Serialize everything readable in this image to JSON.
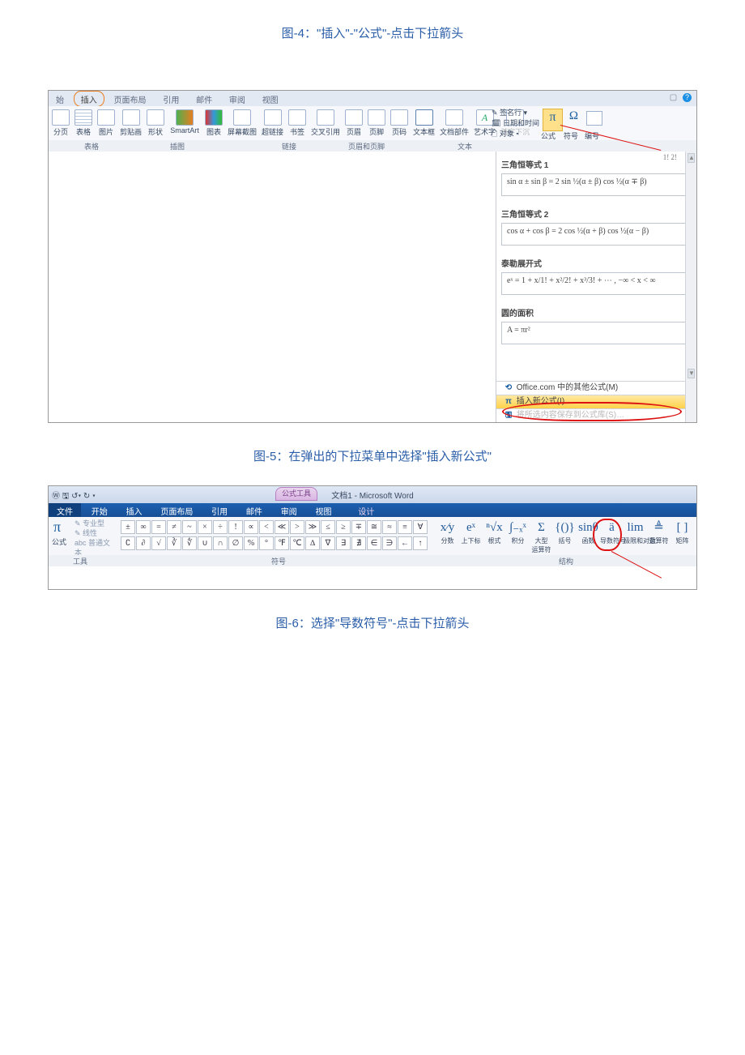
{
  "captions": {
    "c4": "图-4：\"插入\"-\"公式\"-点击下拉箭头",
    "c5": "图-5：在弹出的下拉菜单中选择\"插入新公式\"",
    "c6": "图-6：选择\"导数符号\"-点击下拉箭头"
  },
  "shot1": {
    "tabs": {
      "t0": "始",
      "t1": "插入",
      "t2": "页面布局",
      "t3": "引用",
      "t4": "邮件",
      "t5": "审阅",
      "t6": "视图"
    },
    "help_icon": "?",
    "ribbon_items": {
      "i0": "分页",
      "i1": "表格",
      "i2": "图片",
      "i3": "剪贴画",
      "i4": "形状",
      "i5": "SmartArt",
      "i6": "图表",
      "i7": "屏幕截图",
      "i8": "超链接",
      "i9": "书签",
      "i10": "交叉引用",
      "i11": "页眉",
      "i12": "页脚",
      "i13": "页码",
      "i14": "文本框",
      "i15": "文档部件",
      "i16": "艺术字",
      "i17": "首字下沉",
      "i18": "签名行 ▾",
      "i19": "日期和时间",
      "i20": "对象 ▾",
      "i21": "公式",
      "i22": "符号",
      "i23": "编号"
    },
    "ribbon_groups": {
      "g1": "表格",
      "g2": "插图",
      "g3": "链接",
      "g4": "页眉和页脚",
      "g5": "文本"
    },
    "pi": "π",
    "omega": "Ω",
    "frac_hint": "1!    2!",
    "panel": {
      "h1": "三角恒等式 1",
      "e1": "sin α ± sin β = 2 sin ½(α ± β) cos ½(α ∓ β)",
      "h2": "三角恒等式 2",
      "e2": "cos α + cos β = 2 cos ½(α + β) cos ½(α − β)",
      "h3": "泰勒展开式",
      "e3": "eˣ = 1 + x/1! + x²/2! + x³/3! + ⋯ ,   −∞ < x < ∞",
      "h4": "圆的面积",
      "e4": "A = πr²",
      "m1": "Office.com 中的其他公式(M)",
      "m2": "插入新公式(I)",
      "m3": "将所选内容保存到公式库(S)…",
      "m1_glyph": "⟲",
      "m2_glyph": "π"
    }
  },
  "shot2": {
    "title_doc": "文档1 - Microsoft Word",
    "eqtool": "公式工具",
    "tabs": {
      "t0": "文件",
      "t1": "开始",
      "t2": "插入",
      "t3": "页面布局",
      "t4": "引用",
      "t5": "邮件",
      "t6": "审阅",
      "t7": "视图",
      "t8": "设计"
    },
    "left_group": {
      "pi": "π",
      "lbl": "公式",
      "o1": "专业型",
      "o2": "线性",
      "o3": "abc 普通文本",
      "grp": "工具"
    },
    "symbols_row1": [
      "±",
      "∞",
      "=",
      "≠",
      "~",
      "×",
      "÷",
      "!",
      "∝",
      "<",
      "≪",
      ">",
      "≫",
      "≤",
      "≥",
      "∓",
      "≅",
      "≈",
      "≡",
      "∀"
    ],
    "symbols_row2": [
      "∁",
      "∂",
      "√",
      "∛",
      "∜",
      "∪",
      "∩",
      "∅",
      "%",
      "°",
      "℉",
      "℃",
      "∆",
      "∇",
      "∃",
      "∄",
      "∈",
      "∋",
      "←",
      "↑"
    ],
    "sym_group": "符号",
    "structs": {
      "s0": "分数",
      "s1": "上下标",
      "s2": "根式",
      "s3": "积分",
      "s4": "大型\n运算符",
      "s5": "括号",
      "s6": "函数",
      "s7": "导数符号",
      "s8": "极限和对数",
      "s9": "运算符",
      "s10": "矩阵"
    },
    "struct_glyphs": {
      "g0": "x⁄y",
      "g1": "eˣ",
      "g2": "ⁿ√x",
      "g3": "∫₋ₓˣ",
      "g4": "Σ",
      "g5": "{()}",
      "g6": "sinθ",
      "g7": "ä",
      "g8": "lim",
      "g9": "≜",
      "g10": "[ ]"
    },
    "struct_group": "结构"
  }
}
